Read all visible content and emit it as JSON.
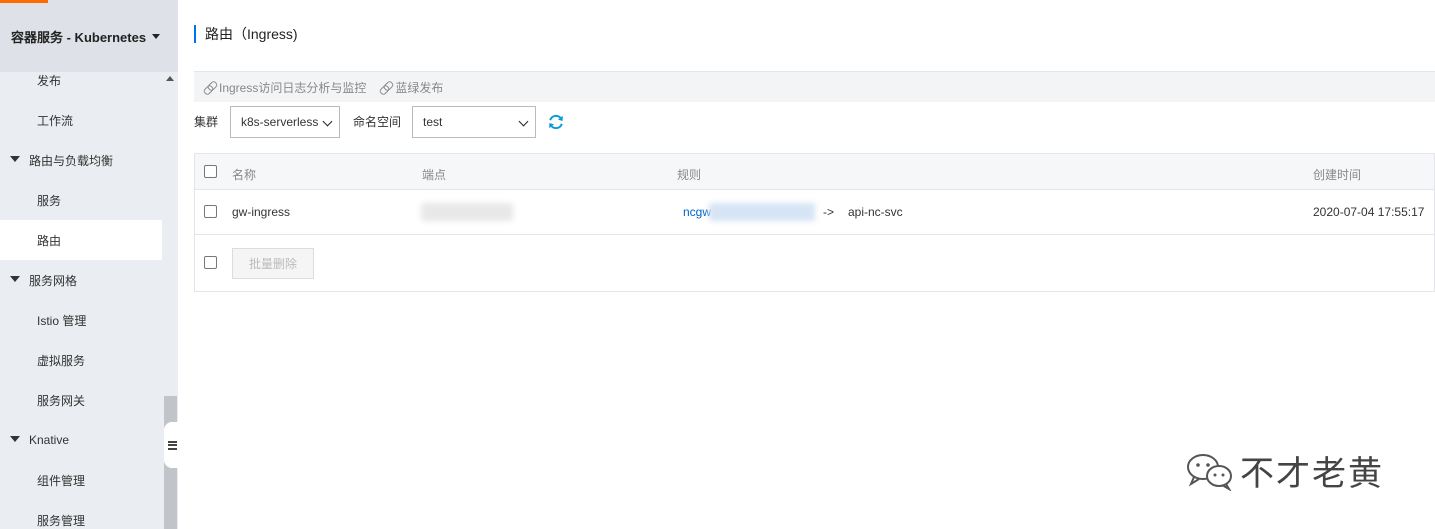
{
  "sidebar": {
    "title": "容器服务 - Kubernetes",
    "items": [
      {
        "label": "发布",
        "type": "child"
      },
      {
        "label": "工作流",
        "type": "child"
      },
      {
        "label": "路由与负载均衡",
        "type": "group"
      },
      {
        "label": "服务",
        "type": "child"
      },
      {
        "label": "路由",
        "type": "child",
        "active": true
      },
      {
        "label": "服务网格",
        "type": "group"
      },
      {
        "label": "Istio 管理",
        "type": "child"
      },
      {
        "label": "虚拟服务",
        "type": "child"
      },
      {
        "label": "服务网关",
        "type": "child"
      },
      {
        "label": "Knative",
        "type": "group"
      },
      {
        "label": "组件管理",
        "type": "child"
      },
      {
        "label": "服务管理",
        "type": "child"
      }
    ]
  },
  "page": {
    "title": "路由（Ingress)"
  },
  "toolbar": {
    "link1": "Ingress访问日志分析与监控",
    "link2": "蓝绿发布"
  },
  "filters": {
    "cluster_label": "集群",
    "cluster_value": "k8s-serverless",
    "namespace_label": "命名空间",
    "namespace_value": "test"
  },
  "table": {
    "headers": {
      "name": "名称",
      "endpoint": "端点",
      "rules": "规则",
      "created": "创建时间"
    },
    "rows": [
      {
        "name": "gw-ingress",
        "rule_host": "ncgw",
        "rule_arrow": "->",
        "rule_service": "api-nc-svc",
        "created": "2020-07-04 17:55:17"
      }
    ],
    "batch_delete_label": "批量删除"
  },
  "watermark": {
    "text": "不才老黄"
  },
  "colors": {
    "accent": "#0073e6",
    "link": "#0064c8",
    "brand_orange": "#ff6a00",
    "refresh": "#0a9bd8"
  }
}
